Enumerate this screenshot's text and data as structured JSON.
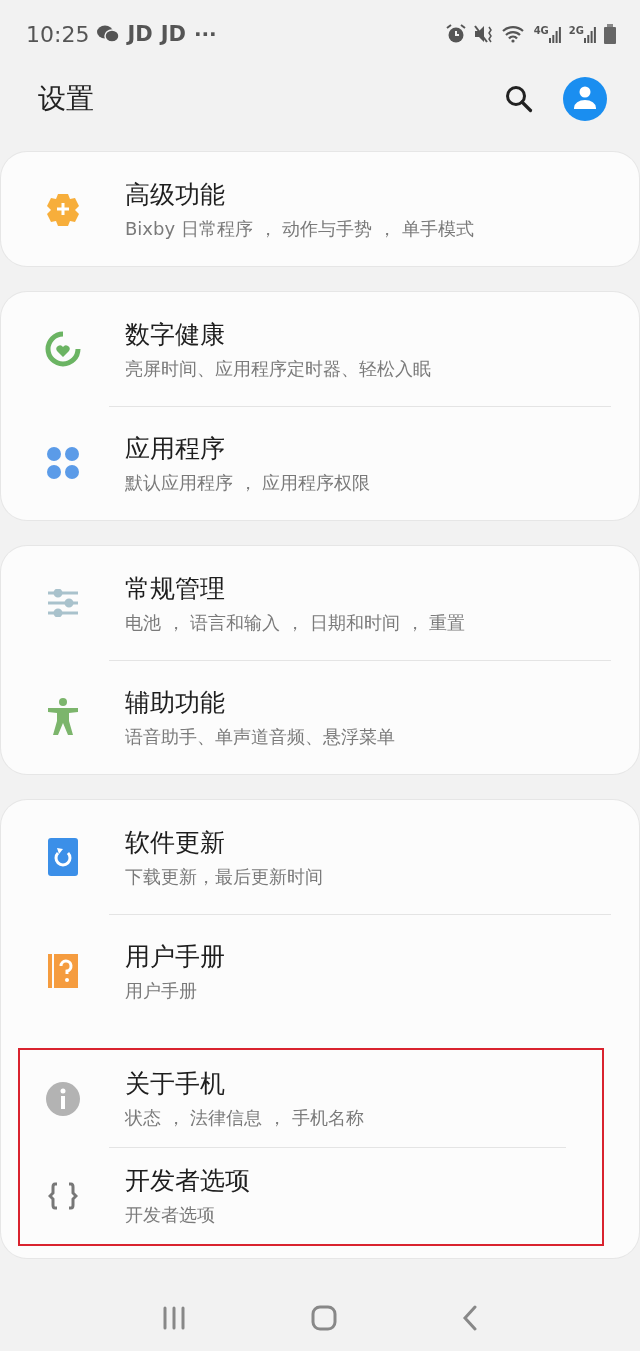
{
  "status_bar": {
    "time": "10:25",
    "app_labels": [
      "JD",
      "JD"
    ],
    "more": "···",
    "network_labels": [
      "4G",
      "2G"
    ]
  },
  "header": {
    "title": "设置"
  },
  "sections": [
    {
      "items": [
        {
          "title": "高级功能",
          "subtitle": "Bixby 日常程序 ， 动作与手势 ， 单手模式",
          "highlighted": false
        }
      ]
    },
    {
      "items": [
        {
          "title": "数字健康",
          "subtitle": "亮屏时间、应用程序定时器、轻松入眠",
          "highlighted": false
        },
        {
          "title": "应用程序",
          "subtitle": "默认应用程序 ， 应用程序权限",
          "highlighted": false
        }
      ]
    },
    {
      "items": [
        {
          "title": "常规管理",
          "subtitle": "电池 ， 语言和输入 ， 日期和时间 ， 重置",
          "highlighted": false
        },
        {
          "title": "辅助功能",
          "subtitle": "语音助手、单声道音频、悬浮菜单",
          "highlighted": false
        }
      ]
    },
    {
      "items": [
        {
          "title": "软件更新",
          "subtitle": "下载更新，最后更新时间",
          "highlighted": false
        },
        {
          "title": "用户手册",
          "subtitle": "用户手册",
          "highlighted": false
        },
        {
          "title": "关于手机",
          "subtitle": "状态 ， 法律信息 ， 手机名称",
          "highlighted": true
        },
        {
          "title": "开发者选项",
          "subtitle": "开发者选项",
          "highlighted": true
        }
      ]
    }
  ]
}
